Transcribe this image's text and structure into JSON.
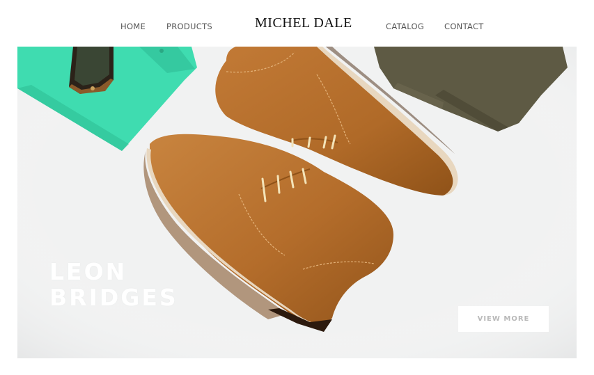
{
  "brand": {
    "name": "MICHEL DALE"
  },
  "nav": {
    "left": [
      {
        "label": "HOME"
      },
      {
        "label": "PRODUCTS"
      }
    ],
    "right": [
      {
        "label": "CATALOG"
      },
      {
        "label": "CONTACT"
      }
    ]
  },
  "hero": {
    "title_line1": "LEON",
    "title_line2": "BRIDGES",
    "cta_label": "VIEW MORE"
  },
  "colors": {
    "background": "#ffffff",
    "hero_backdrop": "#f1f2f2",
    "shoe_leather": "#b8702e",
    "shirt_mint": "#3fdcb0",
    "trousers_olive": "#5e5a44",
    "cta_text": "#b9b9b9"
  }
}
